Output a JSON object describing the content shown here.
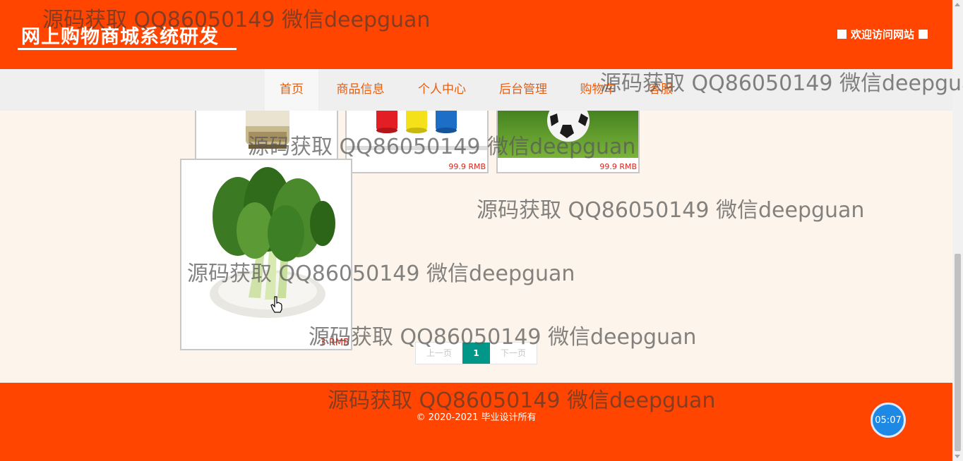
{
  "header": {
    "site_title": "网上购物商城系统研发",
    "welcome_text": "欢迎访问网站"
  },
  "nav": {
    "items": [
      {
        "label": "首页",
        "active": true
      },
      {
        "label": "商品信息",
        "active": false
      },
      {
        "label": "个人中心",
        "active": false
      },
      {
        "label": "后台管理",
        "active": false
      },
      {
        "label": "购物车",
        "active": false
      },
      {
        "label": "客服",
        "active": false
      }
    ]
  },
  "products": [
    {
      "name": "cereal-jar",
      "price": ""
    },
    {
      "name": "paint-cans",
      "price": "99.9 RMB"
    },
    {
      "name": "soccer-ball",
      "price": "99.9 RMB"
    },
    {
      "name": "bok-choy",
      "price": "3 RMB"
    }
  ],
  "pager": {
    "prev_label": "上一页",
    "current_page": "1",
    "next_label": "下一页"
  },
  "footer": {
    "copyright": "© 2020-2021 毕业设计所有"
  },
  "timer": {
    "value": "05:07"
  },
  "watermark": {
    "text": "源码获取 QQ86050149 微信deepguan"
  },
  "colors": {
    "brand": "#ff4500",
    "nav_text": "#e85d0f",
    "price": "#d5281b",
    "pager_active": "#009688"
  }
}
